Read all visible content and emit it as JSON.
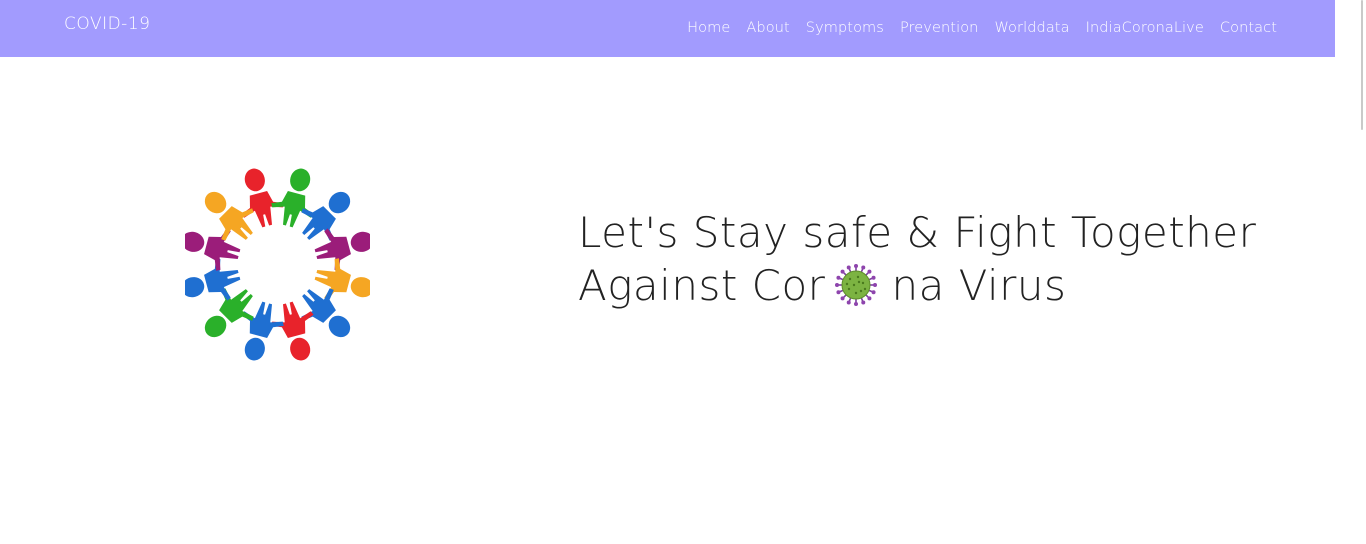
{
  "navbar": {
    "brand": "COVID-19",
    "links": [
      {
        "label": "Home"
      },
      {
        "label": "About"
      },
      {
        "label": "Symptoms"
      },
      {
        "label": "Prevention"
      },
      {
        "label": "Worlddata"
      },
      {
        "label": "IndiaCoronaLive"
      },
      {
        "label": "Contact"
      }
    ],
    "bg_color": "#a29bfe"
  },
  "hero": {
    "image_icon": "people-circle-holding-hands",
    "line1": "Let's Stay safe & Fight Together",
    "line2_before": "Against Cor",
    "line2_icon": "coronavirus-icon",
    "line2_after": "na Virus"
  }
}
